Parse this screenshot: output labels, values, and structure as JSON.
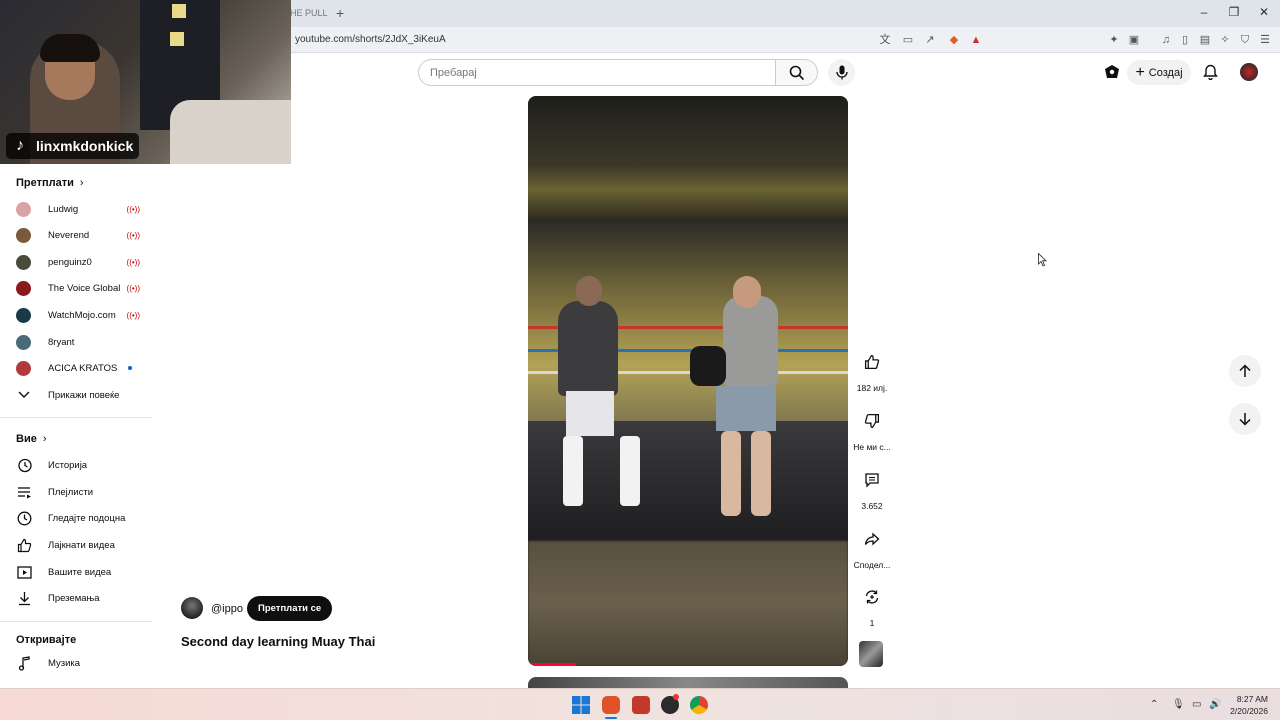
{
  "browser": {
    "tab_text": "HE PULL",
    "url": "youtube.com/shorts/2JdX_3iKeuA"
  },
  "webcam": {
    "handle": "linxmkdonkick"
  },
  "header": {
    "search_placeholder": "Пребарај",
    "create_label": "Создај"
  },
  "sidebar": {
    "subscriptions_title": "Претплати",
    "subscriptions": [
      {
        "name": "Ludwig",
        "status": "live",
        "color": "#d9a3a3"
      },
      {
        "name": "Neverend",
        "status": "live",
        "color": "#7a5a3a"
      },
      {
        "name": "penguinz0",
        "status": "live",
        "color": "#4a4a3a"
      },
      {
        "name": "The Voice Global",
        "status": "live",
        "color": "#8a1a1a"
      },
      {
        "name": "WatchMojo.com",
        "status": "live",
        "color": "#1a3a4a"
      },
      {
        "name": "8ryant",
        "status": "none",
        "color": "#4a6a7a"
      },
      {
        "name": "ACICA KRATOS",
        "status": "new",
        "color": "#b33a3a"
      }
    ],
    "show_more": "Прикажи повеќе",
    "you_title": "Вие",
    "you_items": [
      {
        "label": "Историја",
        "icon": "history-icon"
      },
      {
        "label": "Плејлисти",
        "icon": "playlists-icon"
      },
      {
        "label": "Гледајте подоцна",
        "icon": "watch-later-icon"
      },
      {
        "label": "Лајкнати видеа",
        "icon": "liked-icon"
      },
      {
        "label": "Вашите видеа",
        "icon": "your-videos-icon"
      },
      {
        "label": "Преземања",
        "icon": "downloads-icon"
      }
    ],
    "explore_title": "Откривајте",
    "explore_items": [
      {
        "label": "Музика",
        "icon": "music-icon"
      }
    ]
  },
  "short": {
    "channel": "@ippo",
    "subscribe_label": "Претплати се",
    "title": "Second day learning Muay Thai",
    "progress_fraction": 0.15
  },
  "actions": {
    "likes": "182 илј.",
    "dislike": "Не ми с...",
    "comments": "3.652",
    "share": "Сподел...",
    "remix": "1"
  },
  "taskbar": {
    "time": "8:27 AM",
    "date": "2/20/2026"
  }
}
